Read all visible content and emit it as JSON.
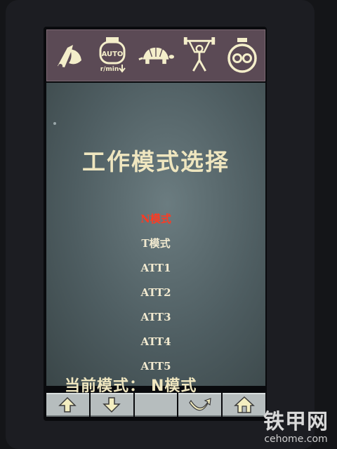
{
  "top_icons": [
    {
      "name": "bucket-arm-icon"
    },
    {
      "name": "auto-engine-icon",
      "line1": "AUTO",
      "line2": "r/min"
    },
    {
      "name": "turtle-icon"
    },
    {
      "name": "weightlifter-icon"
    },
    {
      "name": "hydraulic-pump-icon"
    }
  ],
  "title": "工作模式选择",
  "modes": [
    {
      "label": "N模式",
      "selected": true
    },
    {
      "label": "T模式",
      "selected": false
    },
    {
      "label": "ATT1",
      "selected": false
    },
    {
      "label": "ATT2",
      "selected": false
    },
    {
      "label": "ATT3",
      "selected": false
    },
    {
      "label": "ATT4",
      "selected": false
    },
    {
      "label": "ATT5",
      "selected": false
    }
  ],
  "current_mode": {
    "label": "当前模式：",
    "value": "N模式"
  },
  "softkeys": [
    {
      "name": "up-arrow-icon"
    },
    {
      "name": "down-arrow-icon"
    },
    {
      "name": "blank"
    },
    {
      "name": "return-icon"
    },
    {
      "name": "home-icon"
    }
  ],
  "watermark": {
    "main": "铁甲网",
    "sub": "cehome.com"
  },
  "colors": {
    "selected": "#ff3a22",
    "text": "#f2ead0",
    "iconbar": "#5b4a55",
    "icon": "#f4eeca"
  }
}
